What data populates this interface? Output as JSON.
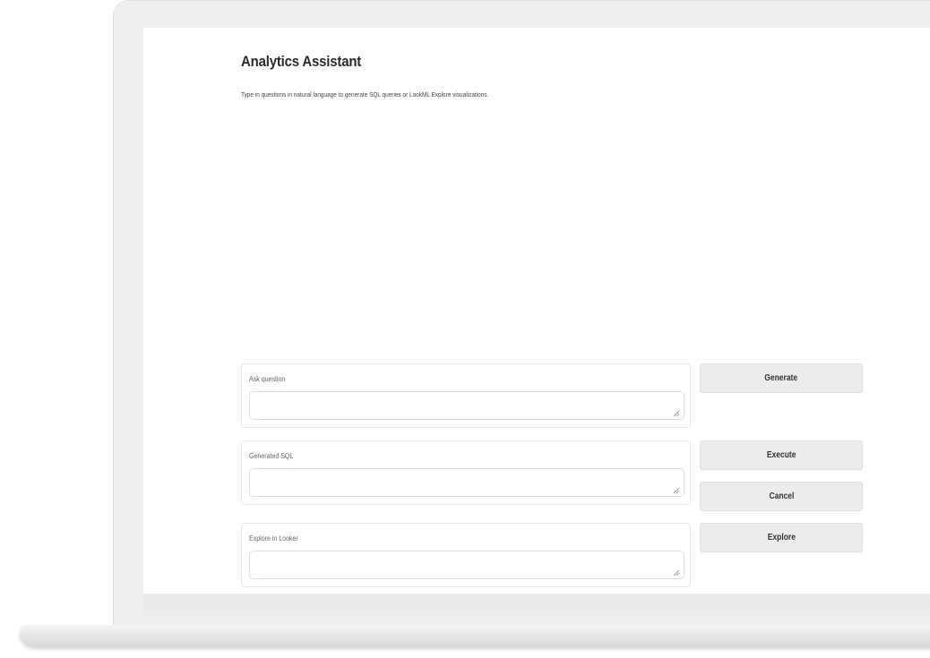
{
  "app": {
    "title": "Analytics Assistant",
    "subtitle": "Type in questions in natural language to generate SQL queries or LookML Explore visualizations."
  },
  "panels": {
    "ask": {
      "label": "Ask question",
      "value": ""
    },
    "sql": {
      "label": "Generated SQL",
      "value": ""
    },
    "explore": {
      "label": "Explore in Looker",
      "value": ""
    }
  },
  "buttons": {
    "generate": "Generate",
    "execute": "Execute",
    "cancel": "Cancel",
    "explore": "Explore"
  },
  "colors": {
    "button_bg": "#ececee",
    "panel_border": "#e6e6e6",
    "bezel": "#efefef"
  }
}
